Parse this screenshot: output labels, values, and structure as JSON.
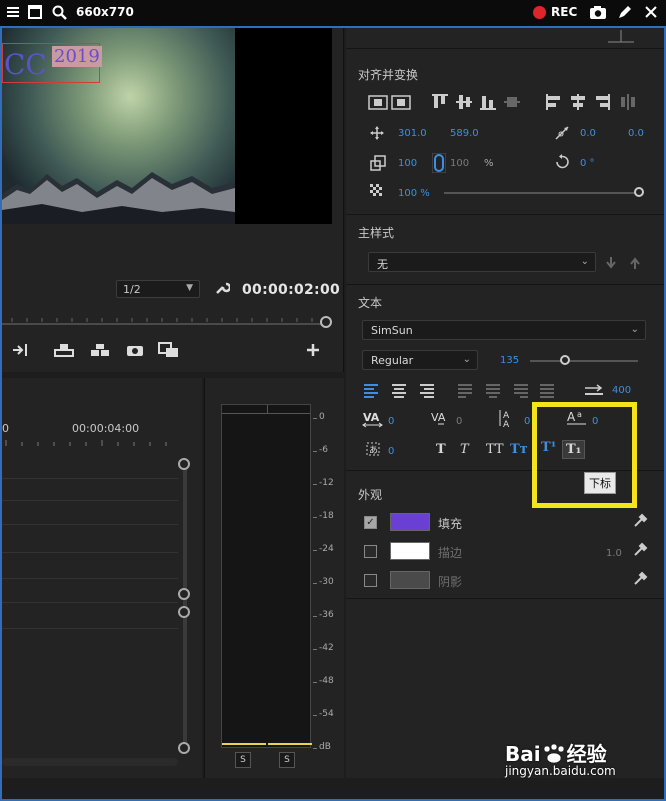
{
  "capture_bar": {
    "dimensions": "660x770",
    "rec_label": "REC",
    "icons": [
      "menu-icon",
      "window-icon",
      "search-icon",
      "record-dot-icon",
      "camera-icon",
      "pen-icon",
      "close-icon"
    ]
  },
  "program_monitor": {
    "title_text_cc": "CC",
    "title_text_year": "2019",
    "resolution": "1/2",
    "timecode": "00:00:02:00"
  },
  "timeline": {
    "time_zero": "0",
    "time_marker": "00:00:04:00"
  },
  "audio_meter": {
    "db_labels": [
      "0",
      "-6",
      "-12",
      "-18",
      "-24",
      "-30",
      "-36",
      "-42",
      "-48",
      "-54",
      "dB"
    ],
    "solo_left": "S",
    "solo_right": "S"
  },
  "essential_graphics": {
    "align_section": {
      "title": "对齐并变换",
      "position_x": "301.0",
      "position_y": "589.0",
      "anchor_x": "0.0",
      "anchor_y": "0.0",
      "scale": "100",
      "scale_linked": "100",
      "scale_unit": "%",
      "rotation": "0 °",
      "opacity": "100 %",
      "opacity_level": 1.0
    },
    "master_style": {
      "title": "主样式",
      "value": "无"
    },
    "text_section": {
      "title": "文本",
      "font": "SimSun",
      "font_style": "Regular",
      "font_size": "135",
      "font_size_level": 0.33,
      "tab_width": "400",
      "tracking": "0",
      "kerning": "0",
      "leading": "0",
      "baseline_shift": "0",
      "tsume": "0",
      "format_buttons": [
        "T",
        "T",
        "TT",
        "Tт",
        "T¹",
        "T₁"
      ],
      "tooltip": "下标"
    },
    "appearance": {
      "title": "外观",
      "fill_label": "填充",
      "fill_color": "#6a3fd4",
      "stroke_label": "描边",
      "stroke_value": "1.0",
      "stroke_color": "#ffffff",
      "shadow_label": "阴影",
      "shadow_color": "#4a4a4a"
    }
  },
  "watermark": {
    "brand": "Bai",
    "brand_suffix": "经验",
    "url": "jingyan.baidu.com"
  },
  "colors": {
    "accent": "#3e8fe0",
    "highlight": "#f3e51b",
    "panel": "#232323"
  }
}
